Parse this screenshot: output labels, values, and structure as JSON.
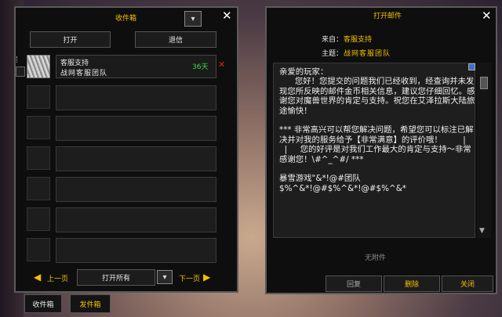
{
  "inbox": {
    "title": "收件箱",
    "open_button": "打开",
    "return_button": "退信",
    "mail": {
      "sender": "客服支持",
      "subject": "战网客服团队",
      "days_left": "36天",
      "delete_glyph": "✕"
    },
    "prev_label": "上一页",
    "next_label": "下一页",
    "open_all_label": "打开所有",
    "tabs": [
      "收件箱",
      "发件箱"
    ]
  },
  "reader": {
    "title": "打开邮件",
    "from_label": "来自：",
    "from_value": "客服支持",
    "subject_label": "主题：",
    "subject_value": "战网客服团队",
    "body": "亲爱的玩家：\n      您好！您提交的问题我们已经收到，经查询并未发现您所反映的邮件金币相关信息，建议您仔细回忆。感谢您对魔兽世界的肯定与支持。祝您在艾泽拉斯大陆旅途愉快！\n\n*** 非常高兴可以帮您解决问题，希望您可以标注已解决并对我的服务给予【非常满意】的评价哦！        |\n  |     您的好评是对我们工作最大的肯定与支持～非常感谢您！\\#^_^#/ ***\n\n暴雪游戏\"&*!@#团队\n$%^&*!@#$%^&*!@#$%^&*",
    "no_attachment": "无附件",
    "reply_button": "回复",
    "delete_button": "删除",
    "close_button": "关闭"
  },
  "colors": {
    "gold": "#f2c100",
    "green": "#3fdc3f",
    "red": "#e02020",
    "panel": "#0e0e0e"
  },
  "icons": [
    "close-icon",
    "chevron-down-icon",
    "arrow-left-icon",
    "arrow-right-icon",
    "scroll-up-icon",
    "scroll-down-icon"
  ]
}
